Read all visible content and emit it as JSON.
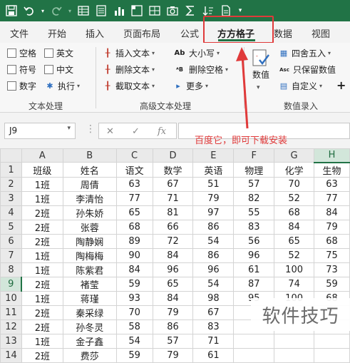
{
  "colors": {
    "title_bar": "#217346",
    "annotation": "#e03a3a",
    "selected_header": "#d2e6da"
  },
  "quick_access": [
    "save-icon",
    "undo-icon",
    "redo-icon",
    "table-icon",
    "form-icon",
    "chart-icon",
    "pivot-icon",
    "grid-icon",
    "camera-icon",
    "sum-icon",
    "sort-icon",
    "text-icon"
  ],
  "tabs": [
    {
      "label": "文件"
    },
    {
      "label": "开始"
    },
    {
      "label": "插入"
    },
    {
      "label": "页面布局"
    },
    {
      "label": "公式"
    },
    {
      "label": "方方格子",
      "active": true
    },
    {
      "label": "数据"
    },
    {
      "label": "视图"
    }
  ],
  "ribbon": {
    "text_group": {
      "checkboxes": [
        "空格",
        "英文",
        "符号",
        "中文",
        "数字"
      ],
      "execute": "执行",
      "label": "文本处理"
    },
    "advanced_group": {
      "insert_text": "插入文本",
      "delete_text": "删除文本",
      "extract_text": "截取文本",
      "case": "大小写",
      "delete_space": "删除空格",
      "more": "更多",
      "label": "高级文本处理"
    },
    "number_group": {
      "number": "数值",
      "round": "四舍五入",
      "keep_number": "只保留数值",
      "custom": "自定义",
      "plus": "+",
      "label": "数值录入"
    }
  },
  "formula_bar": {
    "cell_ref": "J9",
    "fx": "fx"
  },
  "annotation": "百度它，即可下载安装",
  "watermark": "软件技巧",
  "sheet": {
    "columns": [
      "A",
      "B",
      "C",
      "D",
      "E",
      "F",
      "G",
      "H"
    ],
    "rows": [
      {
        "n": "1",
        "cells": [
          "班级",
          "姓名",
          "语文",
          "数学",
          "英语",
          "物理",
          "化学",
          "生物"
        ]
      },
      {
        "n": "2",
        "cells": [
          "1班",
          "周倩",
          "63",
          "67",
          "51",
          "57",
          "70",
          "63"
        ]
      },
      {
        "n": "3",
        "cells": [
          "1班",
          "李清怡",
          "77",
          "71",
          "79",
          "82",
          "52",
          "77"
        ]
      },
      {
        "n": "4",
        "cells": [
          "2班",
          "孙朱娇",
          "65",
          "81",
          "97",
          "55",
          "68",
          "84"
        ]
      },
      {
        "n": "5",
        "cells": [
          "2班",
          "张蓉",
          "68",
          "66",
          "86",
          "83",
          "84",
          "79"
        ]
      },
      {
        "n": "6",
        "cells": [
          "2班",
          "陶静娴",
          "89",
          "72",
          "54",
          "56",
          "65",
          "68"
        ]
      },
      {
        "n": "7",
        "cells": [
          "1班",
          "陶梅梅",
          "90",
          "84",
          "86",
          "96",
          "52",
          "75"
        ]
      },
      {
        "n": "8",
        "cells": [
          "1班",
          "陈紫君",
          "84",
          "96",
          "96",
          "61",
          "100",
          "73"
        ]
      },
      {
        "n": "9",
        "cells": [
          "2班",
          "褚莹",
          "59",
          "65",
          "54",
          "87",
          "74",
          "59"
        ]
      },
      {
        "n": "10",
        "cells": [
          "1班",
          "蒋瑾",
          "93",
          "84",
          "98",
          "95",
          "100",
          "68"
        ]
      },
      {
        "n": "11",
        "cells": [
          "2班",
          "秦采绿",
          "70",
          "79",
          "67",
          "",
          "",
          ""
        ]
      },
      {
        "n": "12",
        "cells": [
          "2班",
          "孙冬灵",
          "58",
          "86",
          "83",
          "",
          "",
          ""
        ]
      },
      {
        "n": "13",
        "cells": [
          "1班",
          "金子鑫",
          "54",
          "57",
          "71",
          "",
          "",
          ""
        ]
      },
      {
        "n": "14",
        "cells": [
          "2班",
          "费莎",
          "59",
          "79",
          "61",
          "",
          "",
          ""
        ]
      }
    ]
  }
}
